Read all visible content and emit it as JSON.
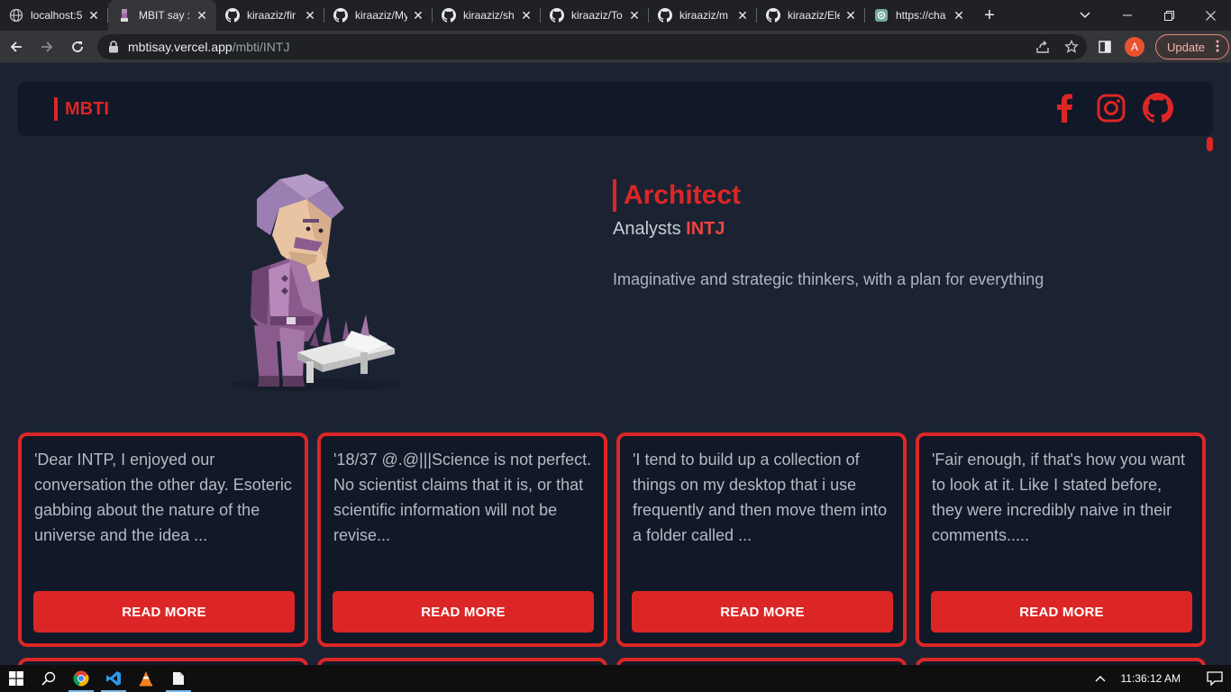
{
  "browser": {
    "tabs": [
      {
        "title": "localhost:5",
        "icon": "globe-icon",
        "active": false
      },
      {
        "title": "MBIT say :",
        "icon": "mbti-favicon-icon",
        "active": true
      },
      {
        "title": "kiraaziz/fir",
        "icon": "github-icon",
        "active": false
      },
      {
        "title": "kiraaziz/My",
        "icon": "github-icon",
        "active": false
      },
      {
        "title": "kiraaziz/sh",
        "icon": "github-icon",
        "active": false
      },
      {
        "title": "kiraaziz/To",
        "icon": "github-icon",
        "active": false
      },
      {
        "title": "kiraaziz/m",
        "icon": "github-icon",
        "active": false
      },
      {
        "title": "kiraaziz/Ele",
        "icon": "github-icon",
        "active": false
      },
      {
        "title": "https://cha",
        "icon": "chatgpt-icon",
        "active": false
      }
    ],
    "url_domain": "mbtisay.vercel.app",
    "url_path": "/mbti/INTJ",
    "profile_initial": "A",
    "update_label": "Update"
  },
  "site": {
    "brand": "MBTI",
    "social_icons": [
      "facebook-icon",
      "instagram-icon",
      "github-icon"
    ]
  },
  "hero": {
    "title": "Architect",
    "group": "Analysts",
    "code": "INTJ",
    "description": "Imaginative and strategic thinkers, with a plan for everything"
  },
  "cards": [
    {
      "quote": "'Dear INTP, I enjoyed our conversation the other day. Esoteric gabbing about the nature of the universe and the idea ...",
      "button": "READ MORE"
    },
    {
      "quote": "'18/37 @.@|||Science is not perfect. No scientist claims that it is, or that scientific information will not be revise...",
      "button": "READ MORE"
    },
    {
      "quote": "'I tend to build up a collection of things on my desktop that i use frequently and then move them into a folder called ...",
      "button": "READ MORE"
    },
    {
      "quote": "'Fair enough, if that's how you want to look at it. Like I stated before, they were incredibly naive in their comments.....",
      "button": "READ MORE"
    }
  ],
  "taskbar": {
    "clock": "11:36:12 AM"
  },
  "colors": {
    "accent": "#dc2626",
    "page_bg": "#1b2333",
    "card_bg": "#111827"
  }
}
